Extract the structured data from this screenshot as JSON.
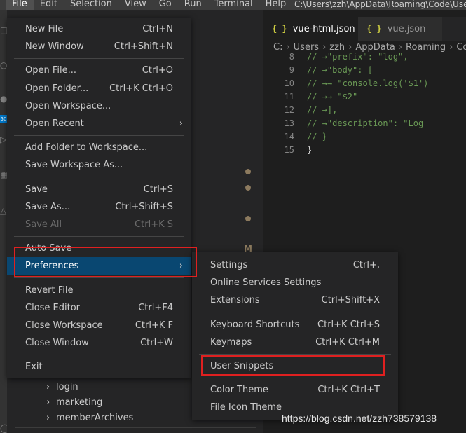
{
  "menubar": {
    "items": [
      "File",
      "Edit",
      "Selection",
      "View",
      "Go",
      "Run",
      "Terminal",
      "Help"
    ],
    "active_index": 0
  },
  "window_path": "C:\\Users\\zzh\\AppData\\Roaming\\Code\\User\\sn",
  "activity_bar": {
    "badge": "50"
  },
  "tabs": [
    {
      "icon": "{ }",
      "label": "vue-html.json",
      "active": true
    },
    {
      "icon": "{ }",
      "label": "vue.json",
      "active": false
    }
  ],
  "breadcrumbs": [
    "C:",
    "Users",
    "zzh",
    "AppData",
    "Roaming",
    "Code"
  ],
  "code_lines": [
    {
      "num": "8",
      "text": "// →\"prefix\": \"log\","
    },
    {
      "num": "9",
      "text": "// →\"body\": ["
    },
    {
      "num": "10",
      "text": "// →→ \"console.log('$1')"
    },
    {
      "num": "11",
      "text": "// →→ \"$2\""
    },
    {
      "num": "12",
      "text": "// →],"
    },
    {
      "num": "13",
      "text": "// →\"description\": \"Log "
    },
    {
      "num": "14",
      "text": "// }"
    },
    {
      "num": "15",
      "text": "}"
    }
  ],
  "sidebar": {
    "modified_badge": "M",
    "tree_items": [
      "login",
      "marketing",
      "memberArchives"
    ]
  },
  "file_menu": {
    "groups": [
      [
        {
          "label": "New File",
          "keys": "Ctrl+N"
        },
        {
          "label": "New Window",
          "keys": "Ctrl+Shift+N"
        }
      ],
      [
        {
          "label": "Open File...",
          "keys": "Ctrl+O"
        },
        {
          "label": "Open Folder...",
          "keys": "Ctrl+K Ctrl+O"
        },
        {
          "label": "Open Workspace...",
          "keys": ""
        },
        {
          "label": "Open Recent",
          "keys": "",
          "submenu": true
        }
      ],
      [
        {
          "label": "Add Folder to Workspace...",
          "keys": ""
        },
        {
          "label": "Save Workspace As...",
          "keys": ""
        }
      ],
      [
        {
          "label": "Save",
          "keys": "Ctrl+S"
        },
        {
          "label": "Save As...",
          "keys": "Ctrl+Shift+S"
        },
        {
          "label": "Save All",
          "keys": "Ctrl+K S",
          "disabled": true
        }
      ],
      [
        {
          "label": "Auto Save",
          "keys": ""
        },
        {
          "label": "Preferences",
          "keys": "",
          "submenu": true,
          "selected": true
        }
      ],
      [
        {
          "label": "Revert File",
          "keys": ""
        },
        {
          "label": "Close Editor",
          "keys": "Ctrl+F4"
        },
        {
          "label": "Close Workspace",
          "keys": "Ctrl+K F"
        },
        {
          "label": "Close Window",
          "keys": "Ctrl+W"
        }
      ],
      [
        {
          "label": "Exit",
          "keys": ""
        }
      ]
    ]
  },
  "preferences_menu": {
    "groups": [
      [
        {
          "label": "Settings",
          "keys": "Ctrl+,"
        },
        {
          "label": "Online Services Settings",
          "keys": ""
        },
        {
          "label": "Extensions",
          "keys": "Ctrl+Shift+X"
        }
      ],
      [
        {
          "label": "Keyboard Shortcuts",
          "keys": "Ctrl+K Ctrl+S"
        },
        {
          "label": "Keymaps",
          "keys": "Ctrl+K Ctrl+M"
        }
      ],
      [
        {
          "label": "User Snippets",
          "keys": "",
          "highlighted": true
        }
      ],
      [
        {
          "label": "Color Theme",
          "keys": "Ctrl+K Ctrl+T"
        },
        {
          "label": "File Icon Theme",
          "keys": ""
        }
      ]
    ]
  },
  "watermark": "https://blog.csdn.net/zzh738579138",
  "colors": {
    "menu_bg": "#252526",
    "selected_bg": "#094771",
    "highlight_border": "#e02020",
    "comment": "#6a9955",
    "json_icon": "#cbcb41"
  }
}
